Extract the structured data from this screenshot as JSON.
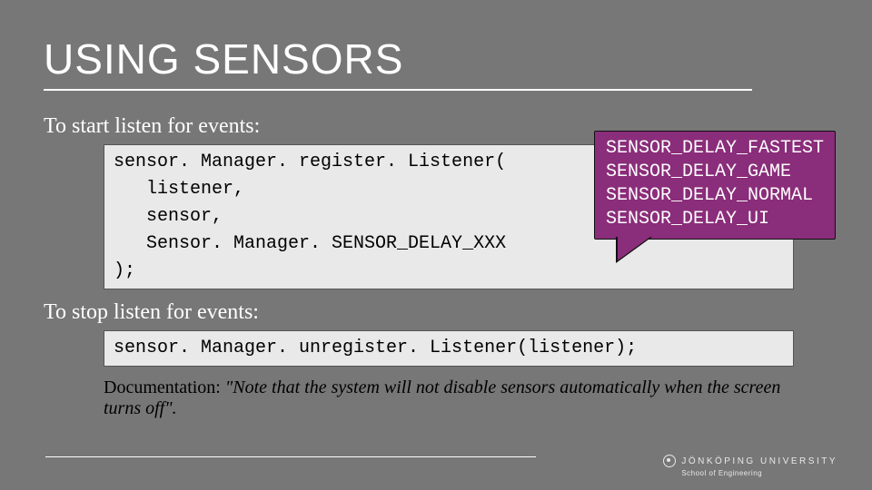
{
  "title": "USING SENSORS",
  "start_text": "To start listen for events:",
  "code1": "sensor. Manager. register. Listener(\n   listener,\n   sensor,\n   Sensor. Manager. SENSOR_DELAY_XXX\n);",
  "callout": {
    "l1": "SENSOR_DELAY_FASTEST",
    "l2": "SENSOR_DELAY_GAME",
    "l3": "SENSOR_DELAY_NORMAL",
    "l4": "SENSOR_DELAY_UI"
  },
  "stop_text": "To stop listen for events:",
  "code2": "sensor. Manager. unregister. Listener(listener);",
  "doc_label": "Documentation: ",
  "doc_quote": "\"Note that the system will not disable sensors automatically when the screen turns off\".",
  "uni_name": "JÖNKÖPING UNIVERSITY",
  "uni_school": "School of Engineering"
}
